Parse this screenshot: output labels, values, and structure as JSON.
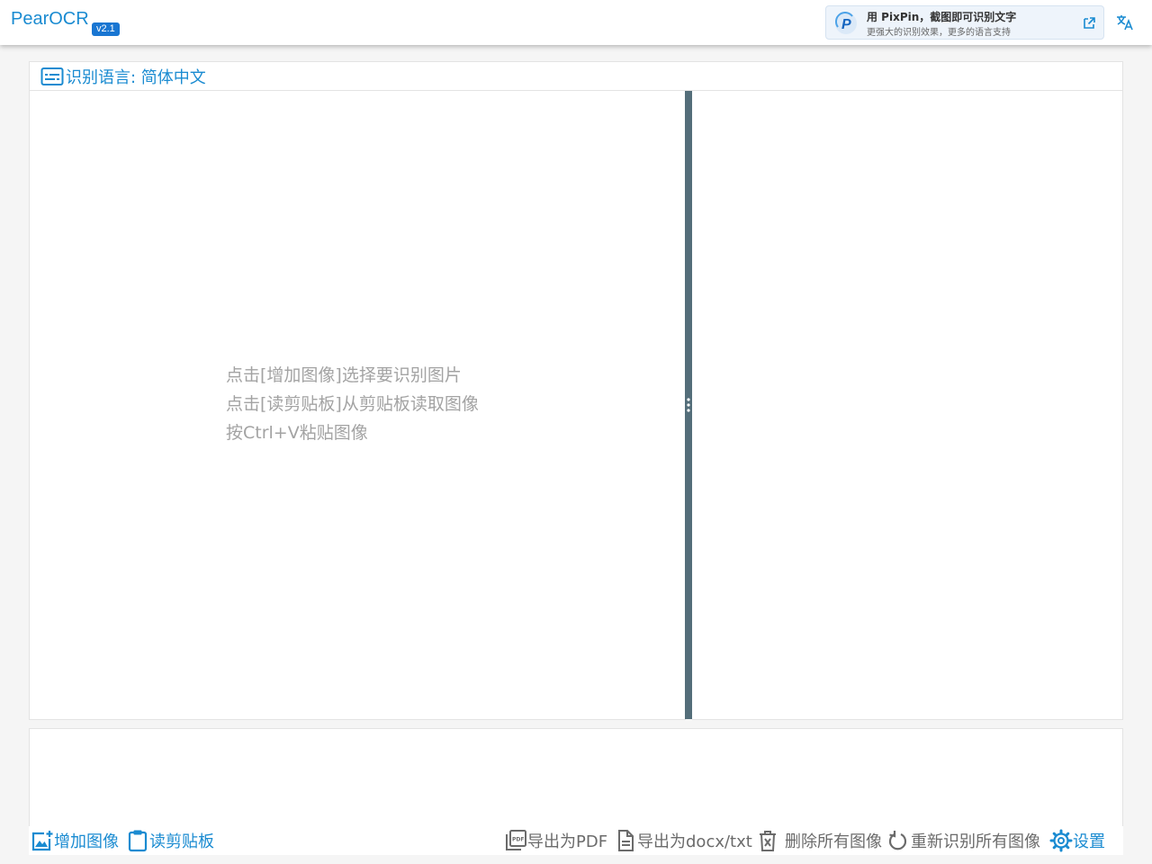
{
  "app": {
    "title": "PearOCR",
    "version": "v2.1"
  },
  "promo": {
    "title": "用 PixPin，截图即可识别文字",
    "subtitle": "更强大的识别效果，更多的语言支持",
    "logo_letter": "P"
  },
  "language": {
    "label": "识别语言: 简体中文"
  },
  "hints": [
    "点击[增加图像]选择要识别图片",
    "点击[读剪贴板]从剪贴板读取图像",
    "按Ctrl+V粘贴图像"
  ],
  "actions": {
    "add_image": "增加图像",
    "read_clipboard": "读剪贴板",
    "export_pdf": "导出为PDF",
    "export_docx": "导出为docx/txt",
    "delete_all": "删除所有图像",
    "re_recognize": "重新识别所有图像",
    "settings": "设置"
  },
  "icons": {
    "promo_logo": "pixpin-logo-icon",
    "promo_open": "open-external-icon",
    "translate": "translate-icon",
    "language": "subtitles-icon",
    "add_image": "add-image-icon",
    "read_clipboard": "clipboard-icon",
    "export_pdf": "pdf-icon",
    "export_docx": "document-icon",
    "delete_all": "delete-icon",
    "re_recognize": "refresh-icon",
    "settings": "gear-icon"
  },
  "colors": {
    "accent": "#1a8bd1",
    "badge": "#1976d2",
    "splitter": "#546e7a",
    "hint_text": "#a3a3a3",
    "muted_action": "#6b6b6b"
  }
}
